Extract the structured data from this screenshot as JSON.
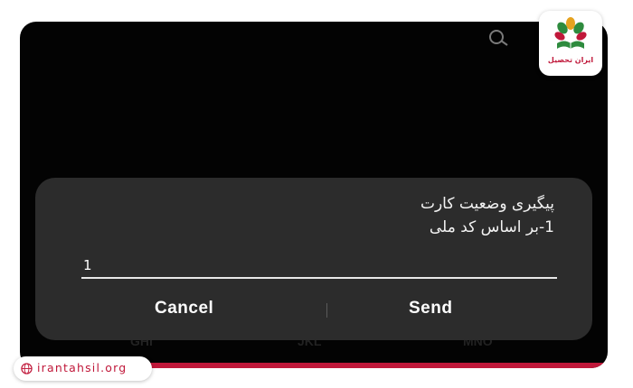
{
  "screen": {
    "search_icon": "search-icon"
  },
  "dialog": {
    "message_line1": "پیگیری وضعیت کارت",
    "message_line2": "1-بر اساس کد ملی",
    "input_value": "1",
    "cancel_label": "Cancel",
    "send_label": "Send"
  },
  "background_keys": [
    "GHI",
    "JKL",
    "MNO"
  ],
  "branding": {
    "logo_text": "ایران تحصیل",
    "url": "irantahsil.org"
  },
  "colors": {
    "accent": "#c0183a",
    "dialog_bg": "#2c2c2c",
    "screen_bg": "#030303"
  }
}
